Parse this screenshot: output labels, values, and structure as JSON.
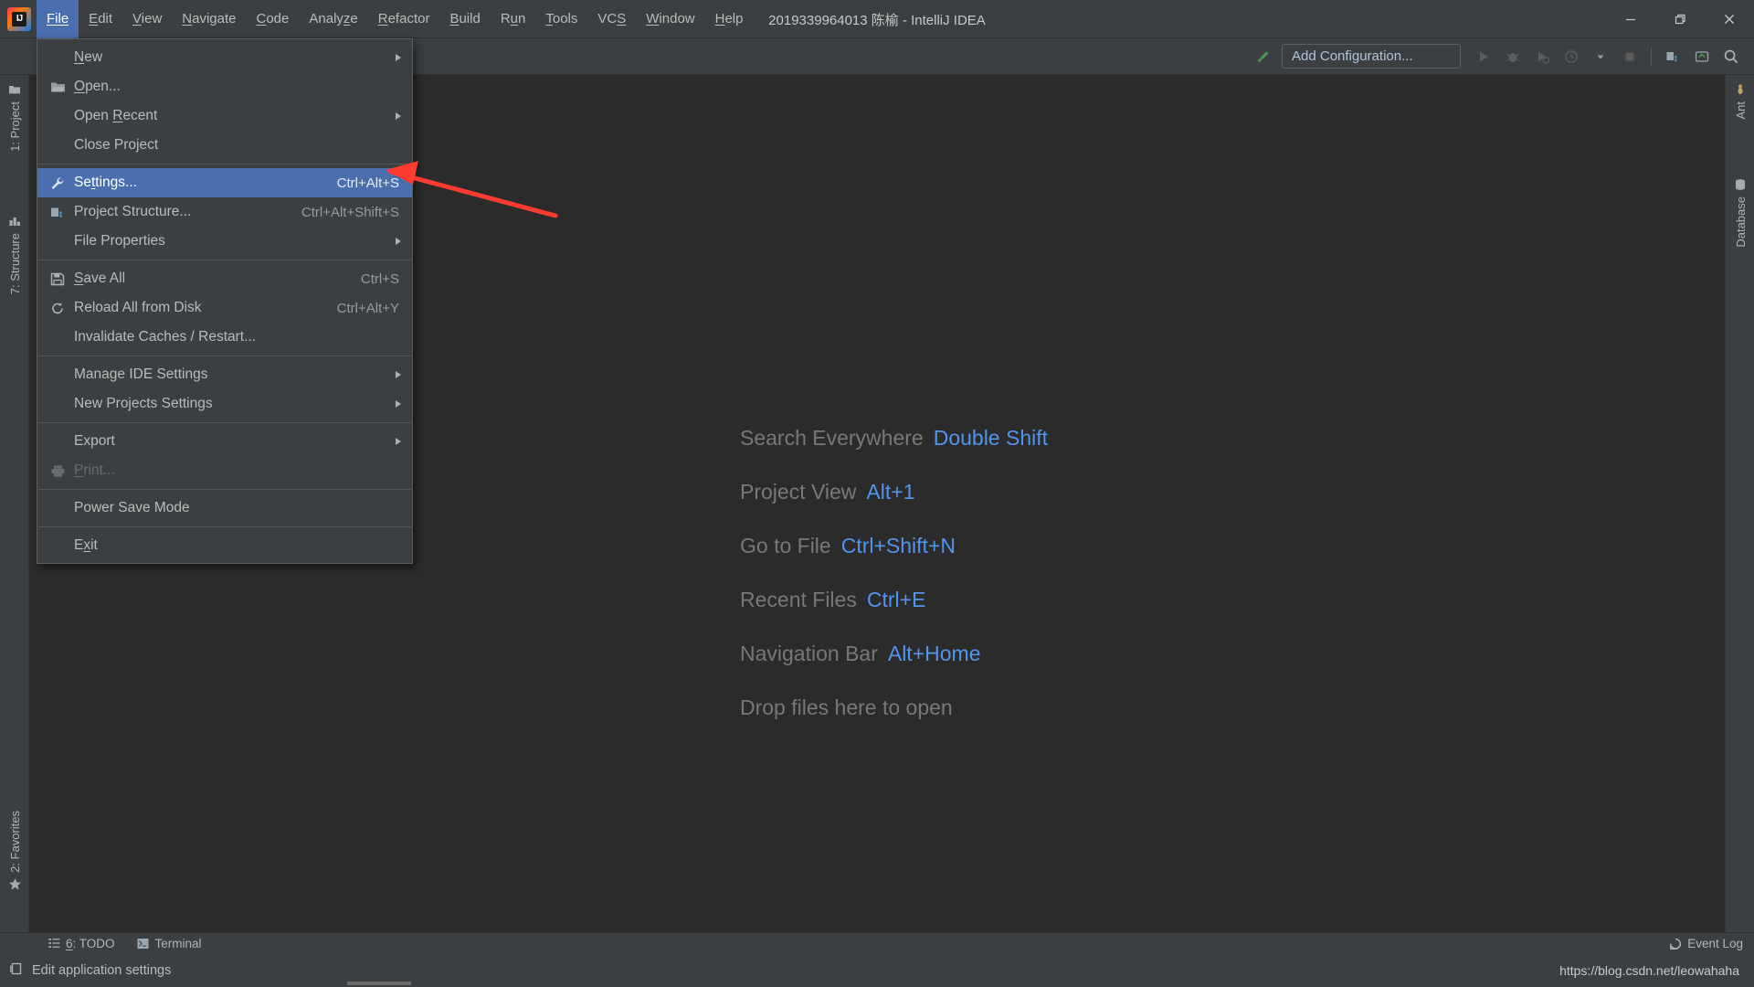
{
  "window": {
    "title": "2019339964013 陈榆 - IntelliJ IDEA",
    "logo_label": "IJ",
    "minimize_label": "Minimize",
    "maximize_label": "Restore",
    "close_label": "Close"
  },
  "menubar": {
    "items": [
      {
        "label": "File",
        "mnemonic": "F",
        "active": true
      },
      {
        "label": "Edit",
        "mnemonic": "E",
        "active": false
      },
      {
        "label": "View",
        "mnemonic": "V",
        "active": false
      },
      {
        "label": "Navigate",
        "mnemonic": "N",
        "active": false
      },
      {
        "label": "Code",
        "mnemonic": "C",
        "active": false
      },
      {
        "label": "Analyze",
        "mnemonic": "z",
        "active": false
      },
      {
        "label": "Refactor",
        "mnemonic": "R",
        "active": false
      },
      {
        "label": "Build",
        "mnemonic": "B",
        "active": false
      },
      {
        "label": "Run",
        "mnemonic": "u",
        "active": false
      },
      {
        "label": "Tools",
        "mnemonic": "T",
        "active": false
      },
      {
        "label": "VCS",
        "mnemonic": "S",
        "active": false
      },
      {
        "label": "Window",
        "mnemonic": "W",
        "active": false
      },
      {
        "label": "Help",
        "mnemonic": "H",
        "active": false
      }
    ]
  },
  "toolbar": {
    "hammer_icon": "build-hammer-icon",
    "add_configuration_label": "Add Configuration...",
    "run_icon": "run-play-icon",
    "debug_icon": "debug-bug-icon",
    "run_coverage_icon": "run-with-coverage-icon",
    "profile_icon": "profiler-icon",
    "profile_dropdown_icon": "chevron-down-icon",
    "stop_icon": "stop-square-icon",
    "project_structure_icon": "project-structure-icon",
    "updates_icon": "updates-icon",
    "search_icon": "search-icon"
  },
  "file_menu": {
    "groups": [
      [
        {
          "label": "New",
          "mnemonic": "N",
          "accel": "",
          "icon": "",
          "submenu": true,
          "selected": false,
          "disabled": false
        },
        {
          "label": "Open...",
          "mnemonic": "O",
          "accel": "",
          "icon": "folder-open-icon",
          "submenu": false,
          "selected": false,
          "disabled": false
        },
        {
          "label": "Open Recent",
          "mnemonic": "R",
          "accel": "",
          "icon": "",
          "submenu": true,
          "selected": false,
          "disabled": false
        },
        {
          "label": "Close Project",
          "mnemonic": "",
          "accel": "",
          "icon": "",
          "submenu": false,
          "selected": false,
          "disabled": false
        }
      ],
      [
        {
          "label": "Settings...",
          "mnemonic": "t",
          "accel": "Ctrl+Alt+S",
          "icon": "wrench-icon",
          "submenu": false,
          "selected": true,
          "disabled": false
        },
        {
          "label": "Project Structure...",
          "mnemonic": "",
          "accel": "Ctrl+Alt+Shift+S",
          "icon": "project-structure-icon",
          "submenu": false,
          "selected": false,
          "disabled": false
        },
        {
          "label": "File Properties",
          "mnemonic": "",
          "accel": "",
          "icon": "",
          "submenu": true,
          "selected": false,
          "disabled": false
        }
      ],
      [
        {
          "label": "Save All",
          "mnemonic": "S",
          "accel": "Ctrl+S",
          "icon": "save-floppy-icon",
          "submenu": false,
          "selected": false,
          "disabled": false
        },
        {
          "label": "Reload All from Disk",
          "mnemonic": "",
          "accel": "Ctrl+Alt+Y",
          "icon": "reload-icon",
          "submenu": false,
          "selected": false,
          "disabled": false
        },
        {
          "label": "Invalidate Caches / Restart...",
          "mnemonic": "",
          "accel": "",
          "icon": "",
          "submenu": false,
          "selected": false,
          "disabled": false
        }
      ],
      [
        {
          "label": "Manage IDE Settings",
          "mnemonic": "",
          "accel": "",
          "icon": "",
          "submenu": true,
          "selected": false,
          "disabled": false
        },
        {
          "label": "New Projects Settings",
          "mnemonic": "",
          "accel": "",
          "icon": "",
          "submenu": true,
          "selected": false,
          "disabled": false
        }
      ],
      [
        {
          "label": "Export",
          "mnemonic": "",
          "accel": "",
          "icon": "",
          "submenu": true,
          "selected": false,
          "disabled": false
        },
        {
          "label": "Print...",
          "mnemonic": "P",
          "accel": "",
          "icon": "printer-icon",
          "submenu": false,
          "selected": false,
          "disabled": true
        }
      ],
      [
        {
          "label": "Power Save Mode",
          "mnemonic": "",
          "accel": "",
          "icon": "",
          "submenu": false,
          "selected": false,
          "disabled": false
        }
      ],
      [
        {
          "label": "Exit",
          "mnemonic": "x",
          "accel": "",
          "icon": "",
          "submenu": false,
          "selected": false,
          "disabled": false
        }
      ]
    ]
  },
  "annotation": {
    "arrow_color": "#ff3b30",
    "arrow_name": "red-pointer-arrow"
  },
  "left_tool_strip": {
    "items": [
      {
        "label": "1: Project",
        "icon": "project-folder-icon"
      },
      {
        "label": "7: Structure",
        "icon": "structure-icon"
      },
      {
        "label": "2: Favorites",
        "icon": "star-icon"
      }
    ]
  },
  "right_tool_strip": {
    "items": [
      {
        "label": "Ant",
        "icon": "ant-icon"
      },
      {
        "label": "Database",
        "icon": "database-icon"
      }
    ]
  },
  "welcome": {
    "rows": [
      {
        "label": "Search Everywhere",
        "key": "Double Shift"
      },
      {
        "label": "Project View",
        "key": "Alt+1"
      },
      {
        "label": "Go to File",
        "key": "Ctrl+Shift+N"
      },
      {
        "label": "Recent Files",
        "key": "Ctrl+E"
      },
      {
        "label": "Navigation Bar",
        "key": "Alt+Home"
      },
      {
        "label": "Drop files here to open",
        "key": ""
      }
    ],
    "key_color": "#5394ec",
    "label_color": "#787878"
  },
  "bottom_bar": {
    "items": [
      {
        "label": "6: TODO",
        "mnemonic": "6",
        "icon": "todo-list-icon"
      },
      {
        "label": "Terminal",
        "mnemonic": "",
        "icon": "terminal-icon"
      }
    ],
    "event_log_label": "Event Log",
    "event_log_icon": "event-log-balloon-icon"
  },
  "status_bar": {
    "message": "Edit application settings",
    "message_icon": "window-hint-icon",
    "watermark": "https://blog.csdn.net/leowahaha"
  }
}
